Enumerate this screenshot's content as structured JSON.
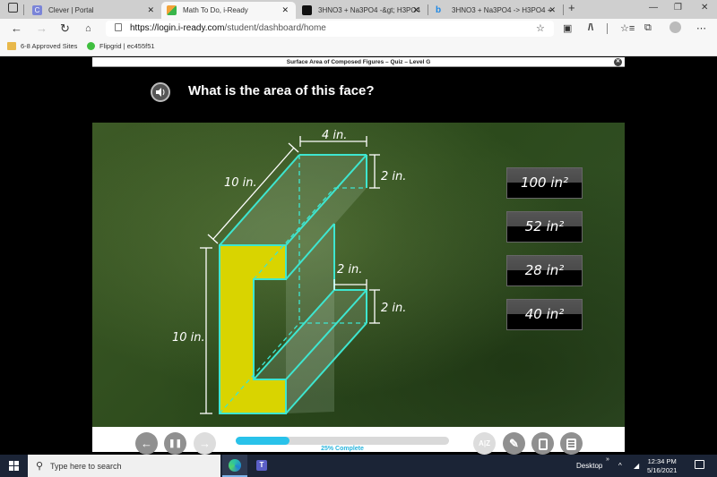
{
  "browser": {
    "tabs": [
      {
        "title": "Clever | Portal",
        "icon": "clever-icon",
        "active": false
      },
      {
        "title": "Math To Do, i-Ready",
        "icon": "iready-icon",
        "active": true
      },
      {
        "title": "3HNO3 + Na3PO4 -&gt; H3PO4",
        "icon": "dark-square-icon",
        "active": false
      },
      {
        "title": "3HNO3 + Na3PO4 -> H3PO4 +",
        "icon": "bing-icon",
        "active": false
      }
    ],
    "new_tab": "+",
    "window_controls": {
      "minimize": "—",
      "restore": "❐",
      "close": "✕"
    },
    "url_host": "https://login.i-ready.com",
    "url_path": "/student/dashboard/home",
    "favorites": [
      {
        "label": "6-8 Approved Sites",
        "icon": "folder-icon"
      },
      {
        "label": "Flipgrid | ec455f51",
        "icon": "flipgrid-icon"
      }
    ]
  },
  "quiz": {
    "title": "Surface Area of Composed Figures – Quiz – Level G",
    "close": "✕",
    "question": "What is the area of this face?",
    "figure": {
      "labels": {
        "depth": "10 in.",
        "top_width": "4 in.",
        "top_height": "2 in.",
        "inner_width": "2 in.",
        "bottom_height": "2 in.",
        "total_height": "10 in."
      },
      "highlight_color": "#d9d400",
      "edge_color": "#3ee6d0"
    },
    "answers": [
      "100 in²",
      "52 in²",
      "28 in²",
      "40 in²"
    ],
    "progress": {
      "percent": 25,
      "label": "25% Complete"
    },
    "controls": {
      "back": "←",
      "pause": "❚❚",
      "forward": "→"
    },
    "tools": [
      "glossary-icon",
      "pencil-icon",
      "notepad-icon",
      "calculator-icon"
    ]
  },
  "taskbar": {
    "search_placeholder": "Type here to search",
    "desktop_label": "Desktop",
    "time": "12:34 PM",
    "date": "5/16/2021"
  }
}
